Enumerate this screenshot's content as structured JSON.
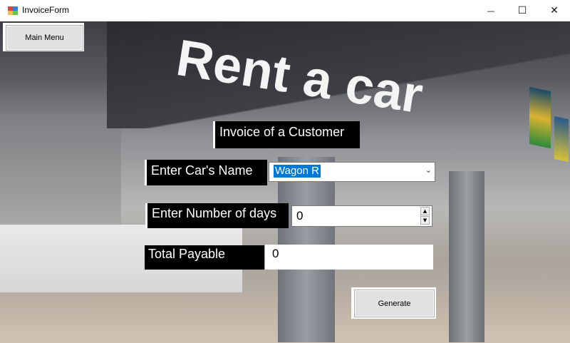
{
  "window": {
    "title": "InvoiceForm",
    "minimize_glyph": "—",
    "maximize_glyph": "☐",
    "close_glyph": "✕"
  },
  "background": {
    "sign_text": "Rent a car"
  },
  "form": {
    "main_menu_label": "Main Menu",
    "heading": "Invoice of a Customer",
    "car_name_label": "Enter Car's Name",
    "car_name_value": "Wagon R",
    "days_label": "Enter Number of days",
    "days_value": "0",
    "total_label": "Total Payable",
    "total_value": "0",
    "generate_label": "Generate"
  },
  "icons": {
    "combo_arrow": "chevron-down-icon",
    "spin_up": "triangle-up-icon",
    "spin_down": "triangle-down-icon"
  }
}
